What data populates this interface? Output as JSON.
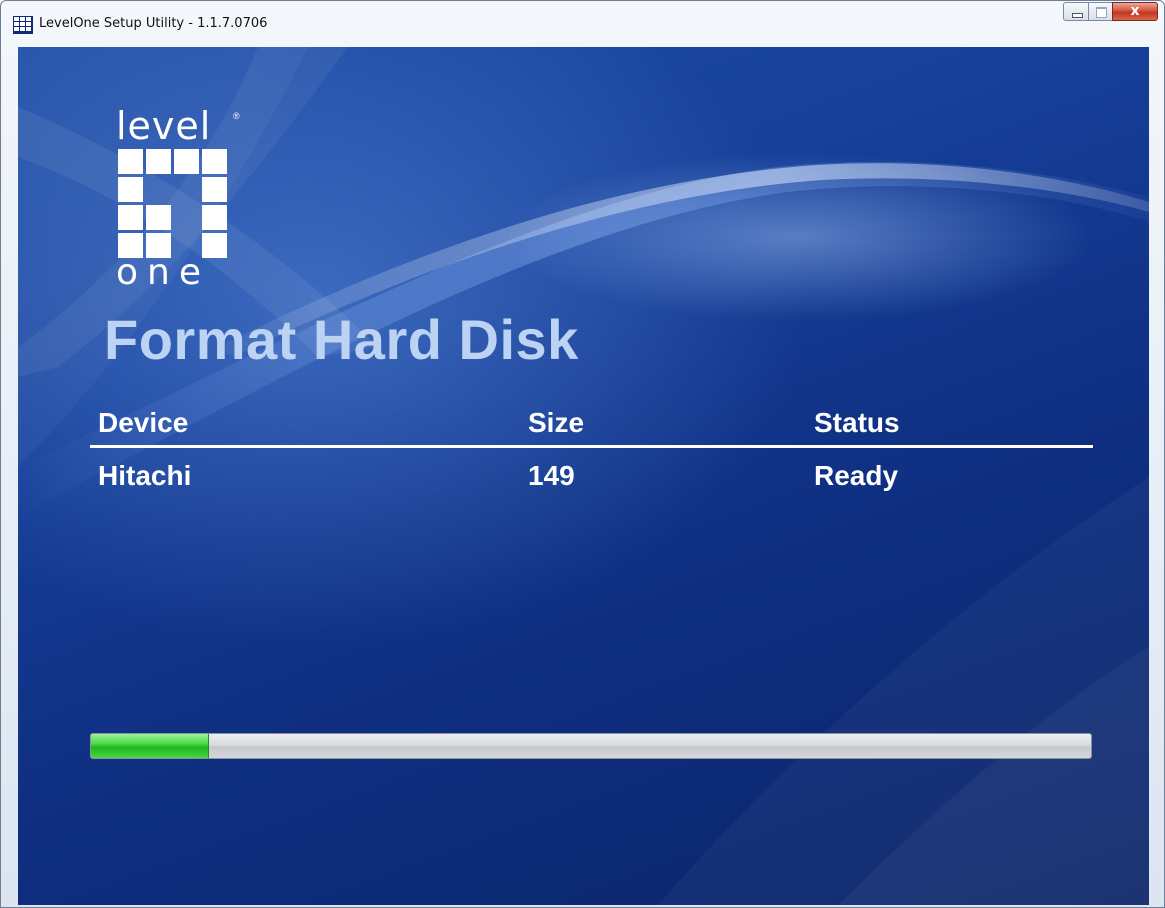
{
  "window": {
    "title": "LevelOne Setup Utility - 1.1.7.0706"
  },
  "caption_buttons": {
    "close_glyph": "x"
  },
  "logo": {
    "text_top": "level",
    "text_bottom": "one",
    "registered": "®"
  },
  "page": {
    "title": "Format Hard Disk"
  },
  "table": {
    "headers": {
      "device": "Device",
      "size": "Size",
      "status": "Status"
    },
    "rows": [
      {
        "device": "Hitachi",
        "size": "149",
        "status": "Ready"
      }
    ]
  },
  "progress": {
    "fraction": 0.117
  },
  "colors": {
    "background": "#17409a",
    "title_text": "#bcd3f3",
    "progress_fill": "#3fcf3b"
  },
  "icons": {
    "app": "levelone-logo-icon",
    "minimize": "minimize-icon",
    "maximize": "maximize-icon",
    "close": "close-icon"
  }
}
